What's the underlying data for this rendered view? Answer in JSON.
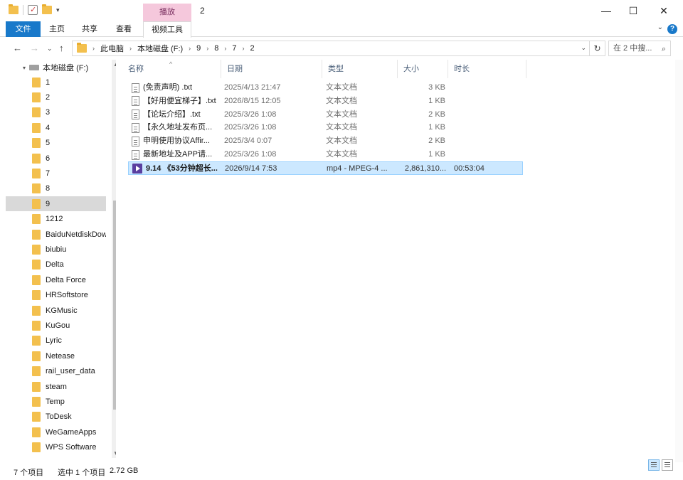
{
  "window": {
    "title": "2",
    "contextual_tab": "播放",
    "minimize": "—",
    "maximize": "☐",
    "close": "✕"
  },
  "ribbon": {
    "tabs": [
      "文件",
      "主页",
      "共享",
      "查看",
      "视频工具"
    ],
    "help": "?"
  },
  "address": {
    "crumbs": [
      "此电脑",
      "本地磁盘 (F:)",
      "9",
      "8",
      "7",
      "2"
    ],
    "search_placeholder": "在 2 中搜..."
  },
  "nav": {
    "root": "本地磁盘 (F:)",
    "selected": "9",
    "items": [
      "1",
      "2",
      "3",
      "4",
      "5",
      "6",
      "7",
      "8",
      "9",
      "1212",
      "BaiduNetdiskDownload",
      "biubiu",
      "Delta",
      "Delta Force",
      "HRSoftstore",
      "KGMusic",
      "KuGou",
      "Lyric",
      "Netease",
      "rail_user_data",
      "steam",
      "Temp",
      "ToDesk",
      "WeGameApps",
      "WPS Software"
    ]
  },
  "columns": {
    "name": "名称",
    "date": "日期",
    "type": "类型",
    "size": "大小",
    "duration": "时长"
  },
  "files": [
    {
      "name": "(免责声明) .txt",
      "date": "2025/4/13 21:47",
      "type": "文本文档",
      "size": "3 KB",
      "duration": "",
      "icon": "txt-file-icon",
      "selected": false
    },
    {
      "name": "【好用便宜梯子】.txt",
      "date": "2026/8/15 12:05",
      "type": "文本文档",
      "size": "1 KB",
      "duration": "",
      "icon": "txt-file-icon",
      "selected": false
    },
    {
      "name": "【论坛介绍】.txt",
      "date": "2025/3/26 1:08",
      "type": "文本文档",
      "size": "2 KB",
      "duration": "",
      "icon": "txt-file-icon",
      "selected": false
    },
    {
      "name": "【永久地址发布页...",
      "date": "2025/3/26 1:08",
      "type": "文本文档",
      "size": "1 KB",
      "duration": "",
      "icon": "txt-file-icon",
      "selected": false
    },
    {
      "name": "申明使用协议Affir...",
      "date": "2025/3/4 0:07",
      "type": "文本文档",
      "size": "2 KB",
      "duration": "",
      "icon": "txt-file-icon",
      "selected": false
    },
    {
      "name": "最新地址及APP请...",
      "date": "2025/3/26 1:08",
      "type": "文本文档",
      "size": "1 KB",
      "duration": "",
      "icon": "txt-file-icon",
      "selected": false
    },
    {
      "name": "9.14 《53分钟超长...",
      "date": "2026/9/14 7:53",
      "type": "mp4 - MPEG-4 ...",
      "size": "2,861,310...",
      "duration": "00:53:04",
      "icon": "video-file-icon",
      "selected": true
    }
  ],
  "status": {
    "count": "7 个项目",
    "selection": "选中 1 个项目",
    "size": "2.72 GB"
  },
  "colors": {
    "accent": "#1979ca",
    "contextual_tab": "#f5c8dc",
    "selection": "#cce8ff",
    "folder": "#f3c04e"
  }
}
